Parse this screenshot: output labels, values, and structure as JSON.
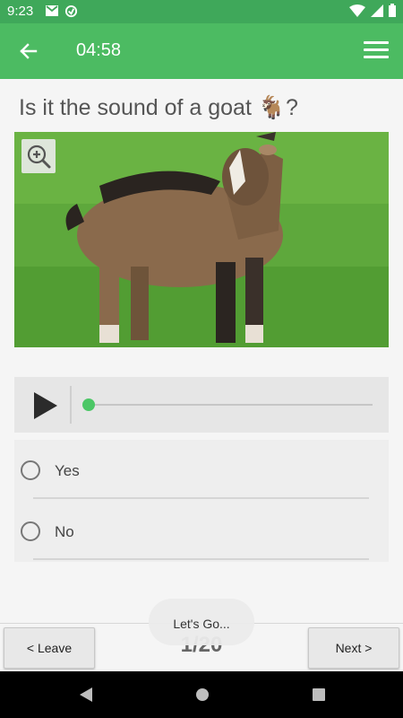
{
  "status_bar": {
    "time": "9:23"
  },
  "app_bar": {
    "timer": "04:58"
  },
  "question": {
    "text": "Is it the sound of a goat 🐐?"
  },
  "player": {
    "progress": 0
  },
  "options": [
    {
      "label": "Yes",
      "selected": false
    },
    {
      "label": "No",
      "selected": false
    }
  ],
  "bottom_bar": {
    "leave_label": "< Leave",
    "next_label": "Next >",
    "progress_text": "1/20"
  },
  "toast": {
    "text": "Let's Go..."
  },
  "colors": {
    "app_bar": "#4cbb62",
    "status_bar": "#3fa85a",
    "accent": "#4cc766"
  }
}
